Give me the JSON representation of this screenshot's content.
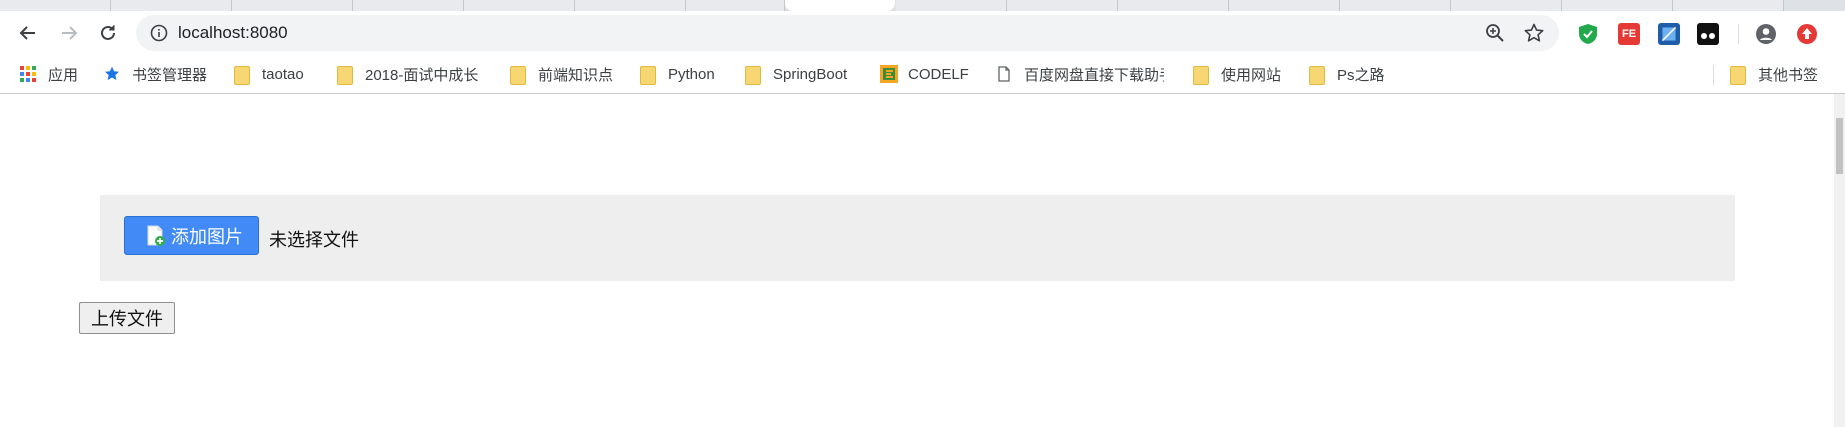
{
  "browser": {
    "url": "localhost:8080",
    "extension_labels": {
      "fe": "FE"
    }
  },
  "bookmarks": [
    {
      "label": "应用",
      "icon": "apps-grid-icon"
    },
    {
      "label": "书签管理器",
      "icon": "star-icon"
    },
    {
      "label": "taotao",
      "icon": "folder-icon"
    },
    {
      "label": "2018-面试中成长",
      "icon": "folder-icon"
    },
    {
      "label": "前端知识点",
      "icon": "folder-icon"
    },
    {
      "label": "Python",
      "icon": "folder-icon"
    },
    {
      "label": "SpringBoot",
      "icon": "folder-icon"
    },
    {
      "label": "CODELF",
      "icon": "codelf-icon"
    },
    {
      "label": "百度网盘直接下载助手",
      "icon": "page-icon"
    },
    {
      "label": "使用网站",
      "icon": "folder-icon"
    },
    {
      "label": "Ps之路",
      "icon": "folder-icon"
    },
    {
      "label": "其他书签",
      "icon": "folder-icon"
    }
  ],
  "page": {
    "add_image_label": "添加图片",
    "no_file_text": "未选择文件",
    "upload_label": "上传文件"
  },
  "colors": {
    "add_button": "#428bf6",
    "panel": "#eeeeee"
  }
}
